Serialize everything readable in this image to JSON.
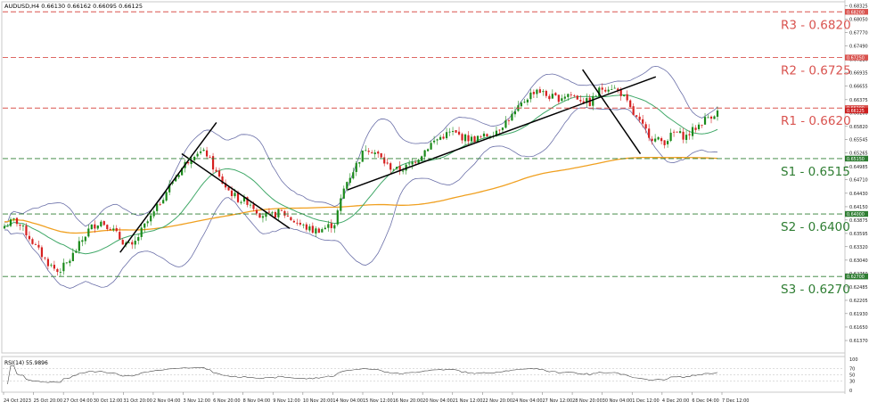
{
  "header": {
    "text": "AUDUSD,H4  0.66130 0.66162 0.66095 0.66125"
  },
  "rsi": {
    "label": "RSI(14) 55.9896",
    "ticks": [
      100,
      70,
      50,
      30,
      0
    ]
  },
  "colors": {
    "resistance": "#d9534f",
    "support": "#2e7d32",
    "ma_orange": "#f0a020",
    "bollinger": "#6a6fa8",
    "ma_green": "#40a868",
    "bull": "#1a8a1a",
    "bear": "#d62020",
    "trendline": "#000000",
    "price_tag": "#cc1f1f"
  },
  "levels": [
    {
      "label": "R3 - 0.6820",
      "value": 0.682,
      "kind": "resistance",
      "tag": "0.68200"
    },
    {
      "label": "R2 - 0.6725",
      "value": 0.6725,
      "kind": "resistance",
      "tag": "0.67250"
    },
    {
      "label": "R1 - 0.6620",
      "value": 0.662,
      "kind": "resistance",
      "tag": "0.66200"
    },
    {
      "label": "S1 - 0.6515",
      "value": 0.6515,
      "kind": "support",
      "tag": "0.65150"
    },
    {
      "label": "S2 - 0.6400",
      "value": 0.64,
      "kind": "support",
      "tag": "0.64000"
    },
    {
      "label": "S3 - 0.6270",
      "value": 0.627,
      "kind": "support",
      "tag": "0.62700"
    }
  ],
  "current_price_tag": "0.66125",
  "chart_data": {
    "type": "line",
    "title": "AUDUSD,H4",
    "ylim": [
      0.6113,
      0.6839
    ],
    "yticks": [
      "0.68325",
      "0.68050",
      "0.67770",
      "0.67490",
      "0.67210",
      "0.66935",
      "0.66655",
      "0.66375",
      "0.66100",
      "0.65820",
      "0.65545",
      "0.65265",
      "0.64985",
      "0.64710",
      "0.64430",
      "0.64150",
      "0.63875",
      "0.63595",
      "0.63320",
      "0.63040",
      "0.62760",
      "0.62485",
      "0.62205",
      "0.61930",
      "0.61650",
      "0.61370"
    ],
    "xlabels": [
      "24 Oct 2023",
      "25 Oct 20:00",
      "27 Oct 04:00",
      "30 Oct 12:00",
      "31 Oct 20:00",
      "2 Nov 04:00",
      "3 Nov 12:00",
      "6 Nov 20:00",
      "8 Nov 04:00",
      "9 Nov 12:00",
      "10 Nov 20:00",
      "14 Nov 04:00",
      "15 Nov 12:00",
      "16 Nov 20:00",
      "20 Nov 04:00",
      "21 Nov 12:00",
      "22 Nov 20:00",
      "24 Nov 04:00",
      "27 Nov 12:00",
      "28 Nov 20:00",
      "30 Nov 04:00",
      "1 Dec 12:00",
      "4 Dec 20:00",
      "6 Dec 04:00",
      "7 Dec 12:00"
    ],
    "close_path": [
      0.6375,
      0.6388,
      0.6362,
      0.633,
      0.63,
      0.628,
      0.63,
      0.6335,
      0.637,
      0.6385,
      0.6372,
      0.6345,
      0.633,
      0.637,
      0.64,
      0.644,
      0.6475,
      0.6505,
      0.653,
      0.6525,
      0.648,
      0.645,
      0.643,
      0.6425,
      0.64,
      0.6395,
      0.6405,
      0.6388,
      0.6375,
      0.6365,
      0.637,
      0.638,
      0.646,
      0.65,
      0.654,
      0.6525,
      0.65,
      0.649,
      0.65,
      0.652,
      0.6545,
      0.656,
      0.657,
      0.656,
      0.6555,
      0.656,
      0.657,
      0.659,
      0.661,
      0.664,
      0.666,
      0.6645,
      0.664,
      0.665,
      0.664,
      0.663,
      0.666,
      0.6665,
      0.665,
      0.661,
      0.658,
      0.6555,
      0.655,
      0.657,
      0.656,
      0.658,
      0.66,
      0.6612
    ],
    "indicators": [
      "SMA 200 (orange)",
      "Bollinger Bands 20 (blue)",
      "SMA 20 (green)"
    ],
    "grid": false
  }
}
